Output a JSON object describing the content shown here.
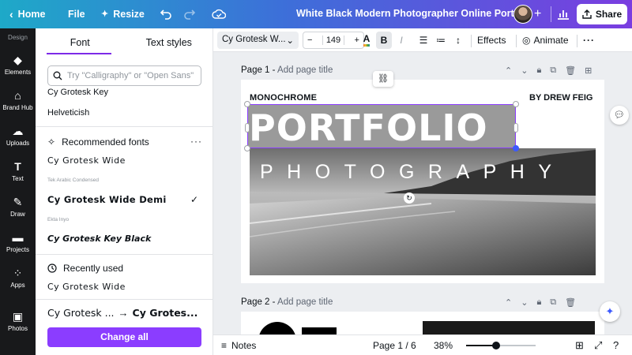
{
  "topbar": {
    "home_label": "Home",
    "file_label": "File",
    "resize_label": "Resize",
    "doc_title": "White Black Modern Photographer Online Portf...",
    "share_label": "Share"
  },
  "rail": {
    "items": [
      {
        "label": "Design",
        "icon": "design-icon"
      },
      {
        "label": "Elements",
        "icon": "elements-icon"
      },
      {
        "label": "Brand Hub",
        "icon": "brand-hub-icon"
      },
      {
        "label": "Uploads",
        "icon": "upload-icon"
      },
      {
        "label": "Text",
        "icon": "text-icon"
      },
      {
        "label": "Draw",
        "icon": "draw-icon"
      },
      {
        "label": "Projects",
        "icon": "folder-icon"
      },
      {
        "label": "Apps",
        "icon": "apps-icon"
      },
      {
        "label": "Photos",
        "icon": "photos-icon"
      }
    ]
  },
  "panel": {
    "tabs": [
      "Font",
      "Text styles"
    ],
    "search_placeholder": "Try \"Calligraphy\" or \"Open Sans\"",
    "fonts_top": [
      "Cy Grotesk Key",
      "Helveticish"
    ],
    "recommended_heading": "Recommended fonts",
    "recommended": [
      {
        "name": "Cy Grotesk Wide",
        "caption": "Tek Arabic Condensed"
      },
      {
        "name": "Cy Grotesk Wide Demi",
        "caption": "Ekta Inyo",
        "selected": true
      },
      {
        "name": "Cy Grotesk Key Black"
      }
    ],
    "recent_heading": "Recently used",
    "recent": [
      "Cy Grotesk Wide"
    ],
    "compare_from": "Cy Grotesk ...",
    "compare_to": "Cy Grotes...",
    "change_all_label": "Change all"
  },
  "toolbar": {
    "font_name": "Cy Grotesk W...",
    "font_size": "149",
    "effects_label": "Effects",
    "animate_label": "Animate"
  },
  "canvas": {
    "page1_label": "Page 1 -",
    "page1_add_title": "Add page title",
    "page2_label": "Page 2 -",
    "page2_add_title": "Add page title",
    "monochrome": "MONOCHROME",
    "by_line": "BY DREW FEIG",
    "portfolio": "PORTFOLIO",
    "photography": "PHOTOGRAPHY"
  },
  "bottombar": {
    "notes_label": "Notes",
    "page_indicator": "Page 1 / 6",
    "zoom": "38%",
    "zoom_level_fraction": 0.43
  },
  "colors": {
    "accent_purple": "#8b3dff",
    "selection": "#8b3dff",
    "rail_bg": "#18191b"
  }
}
